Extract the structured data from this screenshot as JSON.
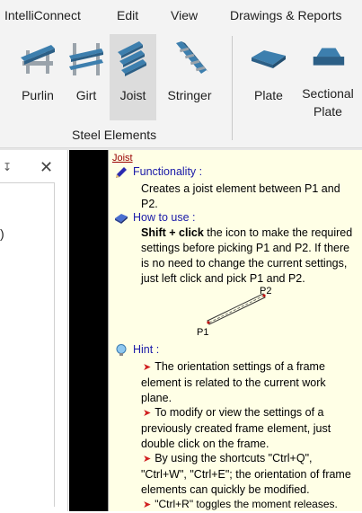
{
  "menu": {
    "items": [
      "IntelliConnect",
      "Edit",
      "View",
      "Drawings & Reports"
    ]
  },
  "ribbon": {
    "group_label": "Steel Elements",
    "buttons": [
      {
        "label": "Purlin",
        "icon": "purlin-icon"
      },
      {
        "label": "Girt",
        "icon": "girt-icon"
      },
      {
        "label": "Joist",
        "icon": "joist-icon",
        "active": true
      },
      {
        "label": "Stringer",
        "icon": "stringer-icon"
      },
      {
        "label": "Plate",
        "icon": "plate-icon"
      },
      {
        "label": "Sectional\nPlate",
        "icon": "sectional-plate-icon"
      }
    ]
  },
  "panel": {
    "pin_glyph": "↧",
    "close_glyph": "✕",
    "cut_text": ")"
  },
  "tooltip": {
    "title": "Joist",
    "functionality_header": "Functionality :",
    "functionality_text": "Creates a joist element between P1 and P2.",
    "howto_header": "How to use :",
    "howto_bold": "Shift + click",
    "howto_text": " the icon to make the required settings before picking P1 and P2. If there is no need to change the current settings, just left click and pick P1 and P2.",
    "diagram": {
      "p1": "P1",
      "p2": "P2"
    },
    "hint_header": "Hint :",
    "hints": [
      "The orientation settings of a frame element is related to the current work plane.",
      "To modify or view the settings of a previously created frame element, just double click on the frame.",
      "By using the shortcuts \"Ctrl+Q\", \"Ctrl+W\", \"Ctrl+E\"; the orientation of frame elements can quickly be modified.",
      "\"Ctrl+R\" toggles the moment releases."
    ]
  },
  "colors": {
    "ribbon_bg": "#f3f3f3",
    "tooltip_bg": "#ffffe6",
    "header_blue": "#1a1aa8",
    "icon_steel": "#3d7fae",
    "hint_arrow": "#d02020"
  }
}
